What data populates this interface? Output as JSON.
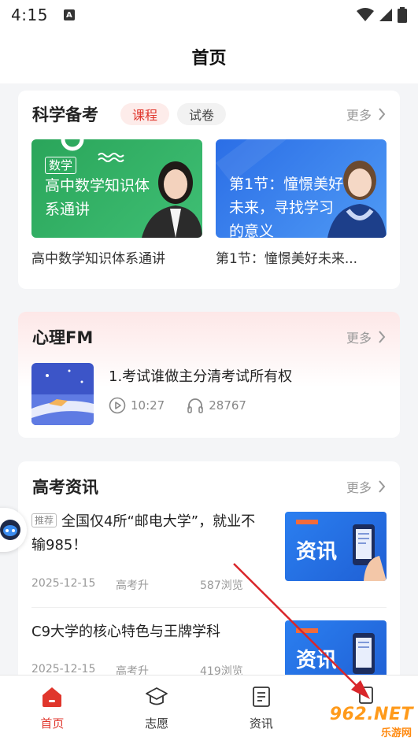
{
  "status_bar": {
    "time": "4:15",
    "notification_icon": "a-icon"
  },
  "header": {
    "title": "首页"
  },
  "science": {
    "title": "科学备考",
    "tabs": [
      {
        "label": "课程",
        "active": true
      },
      {
        "label": "试卷",
        "active": false
      }
    ],
    "more": "更多",
    "courses": [
      {
        "badge": "数学",
        "cover_text": "高中数学知识体系通讲",
        "title": "高中数学知识体系通讲"
      },
      {
        "cover_text": "第1节：憧憬美好未来，寻找学习的意义",
        "title": "第1节：憧憬美好未来..."
      }
    ]
  },
  "fm": {
    "title": "心理FM",
    "more": "更多",
    "item": {
      "title": "1.考试谁做主分清考试所有权",
      "duration": "10:27",
      "listens": "28767"
    }
  },
  "news": {
    "title": "高考资讯",
    "more": "更多",
    "items": [
      {
        "tag": "推荐",
        "title": "全国仅4所“邮电大学”，就业不输985！",
        "date": "2025-12-15",
        "source": "高考升",
        "views": "587浏览",
        "thumb_text": "资讯"
      },
      {
        "title": "C9大学的核心特色与王牌学科",
        "date": "2025-12-15",
        "source": "高考升",
        "views": "419浏览",
        "thumb_text": "资讯"
      }
    ]
  },
  "tabbar": [
    {
      "label": "首页",
      "icon": "home-icon",
      "active": true
    },
    {
      "label": "志愿",
      "icon": "graduation-cap-icon",
      "active": false
    },
    {
      "label": "资讯",
      "icon": "document-icon",
      "active": false
    },
    {
      "label": "",
      "icon": "profile-icon",
      "active": false
    }
  ],
  "watermark": {
    "text": "962.NET",
    "sub": "乐游网"
  },
  "colors": {
    "accent": "#e0362c",
    "fm_bg": "#fde7e7",
    "green_cover": "#2fa35e",
    "blue_cover": "#2e78e8",
    "annotation_arrow": "#d9262a"
  }
}
